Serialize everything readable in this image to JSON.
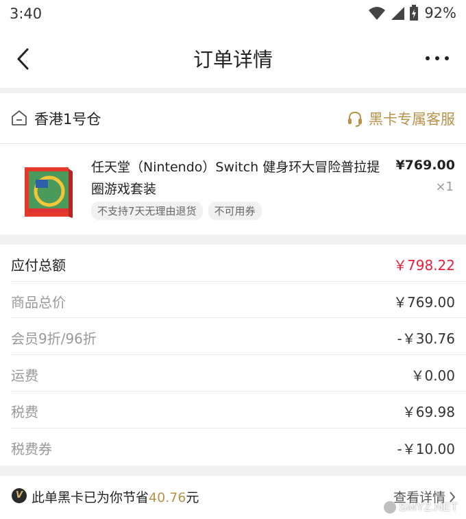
{
  "status_bar": {
    "time": "3:40",
    "battery": "92%"
  },
  "nav": {
    "title": "订单详情"
  },
  "store": {
    "name": "香港1号仓",
    "service_label": "黑卡专属客服"
  },
  "product": {
    "name": "任天堂（Nintendo）Switch 健身环大冒险普拉提圈游戏套装",
    "price": "¥769.00",
    "quantity": "×1",
    "tags": [
      "不支持7天无理由退货",
      "不可用券"
    ]
  },
  "price_rows": [
    {
      "label": "应付总额",
      "value": "￥798.22"
    },
    {
      "label": "商品总价",
      "value": "￥769.00"
    },
    {
      "label": "会员9折/96折",
      "value": "-￥30.76"
    },
    {
      "label": "运费",
      "value": "￥0.00"
    },
    {
      "label": "税费",
      "value": "￥69.98"
    },
    {
      "label": "税费券",
      "value": "-￥10.00"
    }
  ],
  "savings": {
    "badge": "V",
    "text_prefix": "此单黑卡已为你节省",
    "amount": "40.76",
    "text_suffix": "元",
    "detail_label": "查看详情"
  },
  "watermark": "SMYZ.NET",
  "colors": {
    "accent_gold": "#b8924a",
    "total_red": "#e6203a"
  }
}
